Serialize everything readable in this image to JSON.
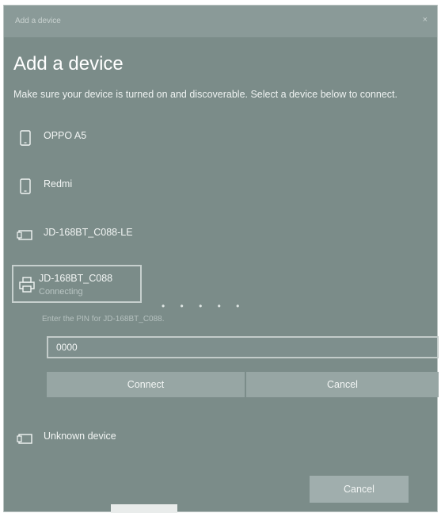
{
  "window": {
    "title": "Add a device",
    "close_glyph": "×"
  },
  "heading": "Add a device",
  "instructions": "Make sure your device is turned on and discoverable. Select a device below to connect.",
  "devices": [
    {
      "name": "OPPO A5",
      "icon": "phone-icon"
    },
    {
      "name": "Redmi",
      "icon": "phone-icon"
    },
    {
      "name": "JD-168BT_C088-LE",
      "icon": "generic-device-icon"
    },
    {
      "name": "JD-168BT_C088",
      "status": "Connecting",
      "icon": "printer-icon",
      "selected": true
    },
    {
      "name": "Unknown device",
      "icon": "generic-device-icon"
    }
  ],
  "progress_dots": "• • • • •",
  "pin": {
    "label": "Enter the PIN for JD-168BT_C088.",
    "value": "0000"
  },
  "buttons": {
    "connect": "Connect",
    "cancel_inline": "Cancel",
    "cancel_main": "Cancel"
  },
  "colors": {
    "background": "#7b8c89",
    "button": "#97a6a4",
    "text": "#ffffff"
  }
}
